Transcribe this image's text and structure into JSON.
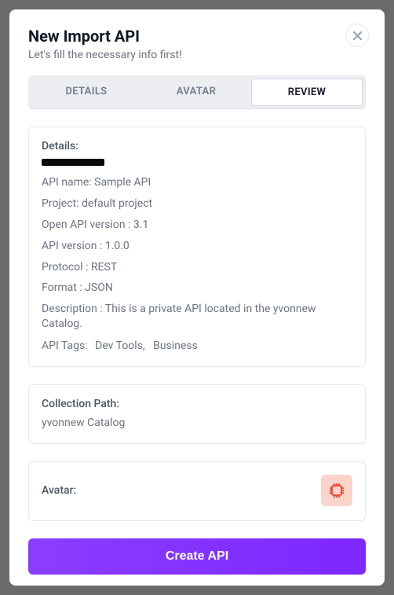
{
  "header": {
    "title": "New Import API",
    "subtitle": "Let's fill the necessary info first!"
  },
  "tabs": {
    "details": "DETAILS",
    "avatar": "AVATAR",
    "review": "REVIEW"
  },
  "details": {
    "section_title": "Details:",
    "api_name": {
      "label": "API name:",
      "value": "Sample API"
    },
    "project": {
      "label": "Project:",
      "value": "default project"
    },
    "openapi_version": {
      "label": "Open API version :",
      "value": "3.1"
    },
    "api_version": {
      "label": "API version :",
      "value": "1.0.0"
    },
    "protocol": {
      "label": "Protocol :",
      "value": "REST"
    },
    "format": {
      "label": "Format :",
      "value": "JSON"
    },
    "description": {
      "label": "Description :",
      "value": "This is a private API located in the yvonnew Catalog."
    },
    "tags": {
      "label": "API Tags:",
      "items": [
        "Dev Tools,",
        "Business"
      ]
    }
  },
  "collection": {
    "label": "Collection Path:",
    "value": "yvonnew Catalog"
  },
  "avatar": {
    "label": "Avatar:"
  },
  "actions": {
    "create": "Create API"
  }
}
